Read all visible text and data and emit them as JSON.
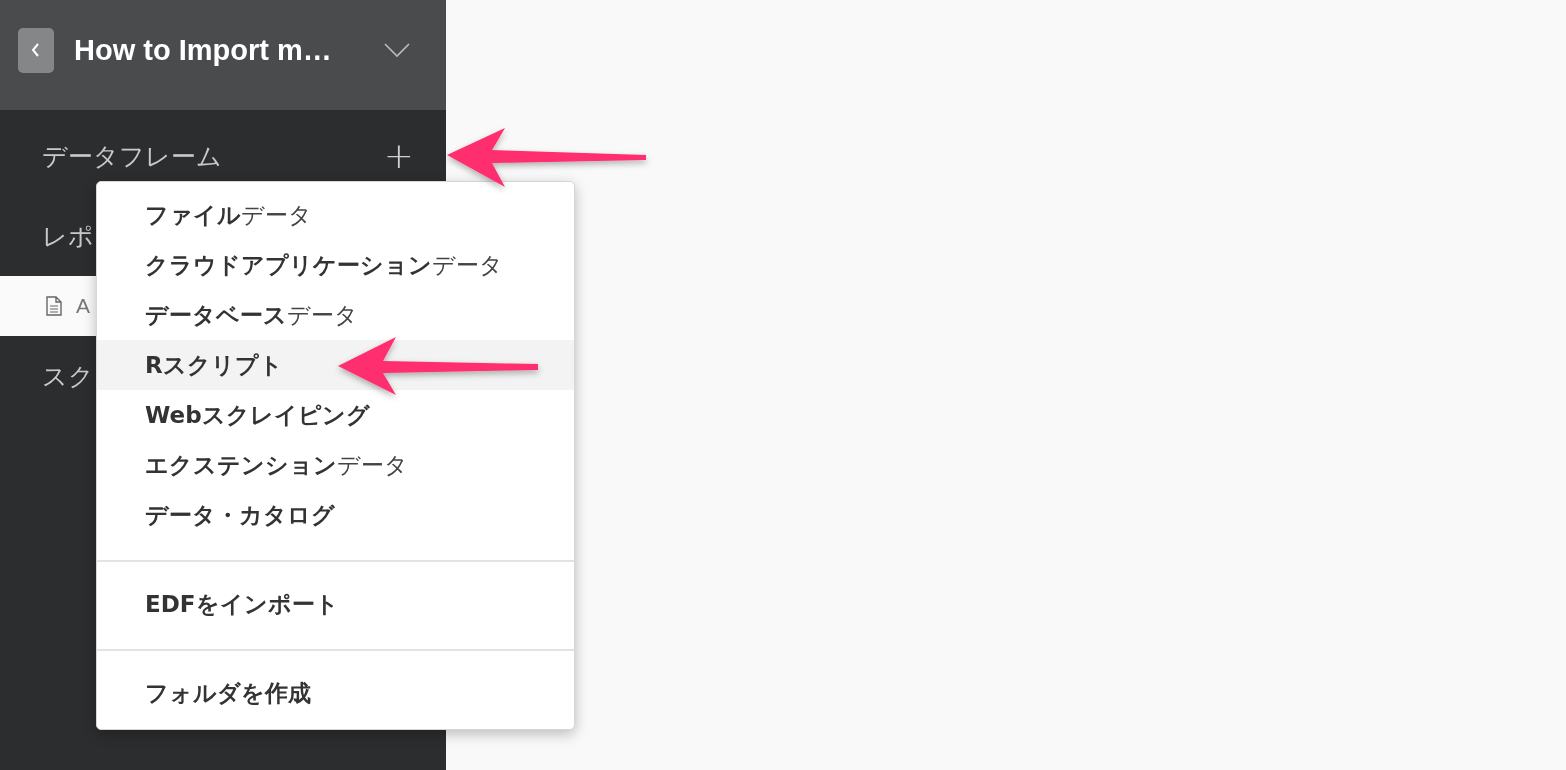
{
  "project": {
    "title": "How to Import m…"
  },
  "sidebar": {
    "items": [
      {
        "kind": "section",
        "label": "データフレーム",
        "add_button": "+"
      },
      {
        "kind": "section",
        "label": "レポ"
      },
      {
        "kind": "file",
        "label": "A",
        "selected": true
      },
      {
        "kind": "section",
        "label": "スク"
      }
    ]
  },
  "menu": {
    "groups": [
      {
        "items": [
          {
            "text": "**ファイル**データ",
            "selected": false
          },
          {
            "text": "**クラウドアプリケーション**データ",
            "selected": false
          },
          {
            "text": "**データベース**データ",
            "selected": false
          },
          {
            "text": "**Rスクリプト**",
            "selected": true
          },
          {
            "text": "**Webスクレイピング**",
            "selected": false
          },
          {
            "text": "**エクステンション**データ",
            "selected": false
          },
          {
            "text": "**データ・カタログ**",
            "selected": false
          }
        ]
      },
      {
        "items": [
          {
            "text": "**EDFをインポート**",
            "selected": false
          }
        ]
      },
      {
        "items": [
          {
            "text": "**フォルダを作成**",
            "selected": false
          }
        ]
      }
    ]
  }
}
